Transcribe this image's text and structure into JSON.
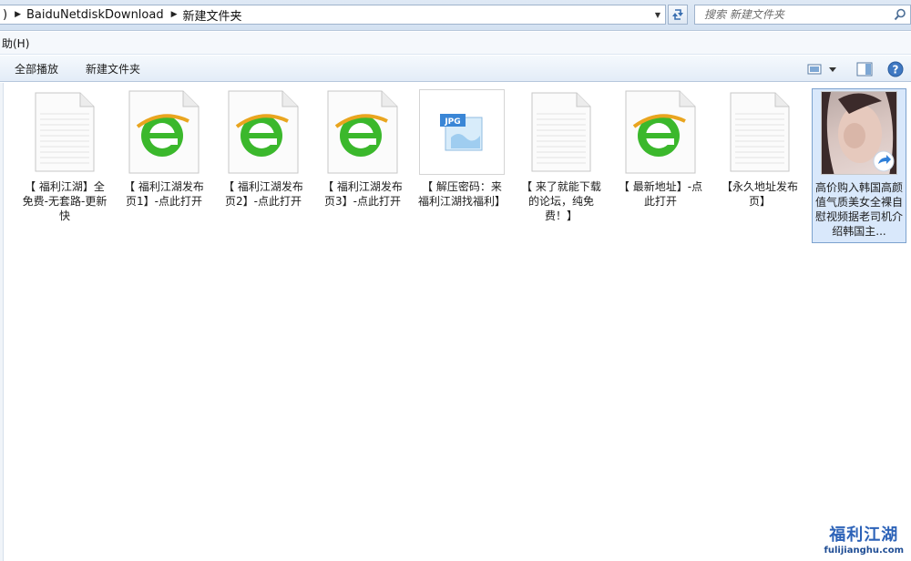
{
  "address": {
    "path": [
      "BaiduNetdiskDownload",
      "新建文件夹"
    ],
    "leading": ")"
  },
  "search": {
    "placeholder": "搜索 新建文件夹"
  },
  "menu": {
    "help": "助(H)"
  },
  "toolbar": {
    "play_all": "全部播放",
    "new_folder": "新建文件夹"
  },
  "files": [
    {
      "name": "【 福利江湖】全免费-无套路-更新快",
      "type": "document"
    },
    {
      "name": "【 福利江湖发布页1】-点此打开",
      "type": "ie-link"
    },
    {
      "name": "【 福利江湖发布页2】-点此打开",
      "type": "ie-link"
    },
    {
      "name": "【 福利江湖发布页3】-点此打开",
      "type": "ie-link"
    },
    {
      "name": "【 解压密码：来福利江湖找福利】",
      "type": "jpg"
    },
    {
      "name": "【 来了就能下载的论坛，纯免费！】",
      "type": "document"
    },
    {
      "name": "【 最新地址】-点此打开",
      "type": "ie-link"
    },
    {
      "name": "【永久地址发布页】",
      "type": "document"
    },
    {
      "name": "高价购入韩国高颜值气质美女全裸自慰视频据老司机介绍韩国主...",
      "type": "video",
      "selected": true
    }
  ],
  "brand": {
    "title": "福利江湖",
    "url": "fulijianghu.com"
  },
  "colors": {
    "accent": "#2d63b8",
    "selection": "#d9e8fb",
    "ie_green": "#3bb82c"
  }
}
